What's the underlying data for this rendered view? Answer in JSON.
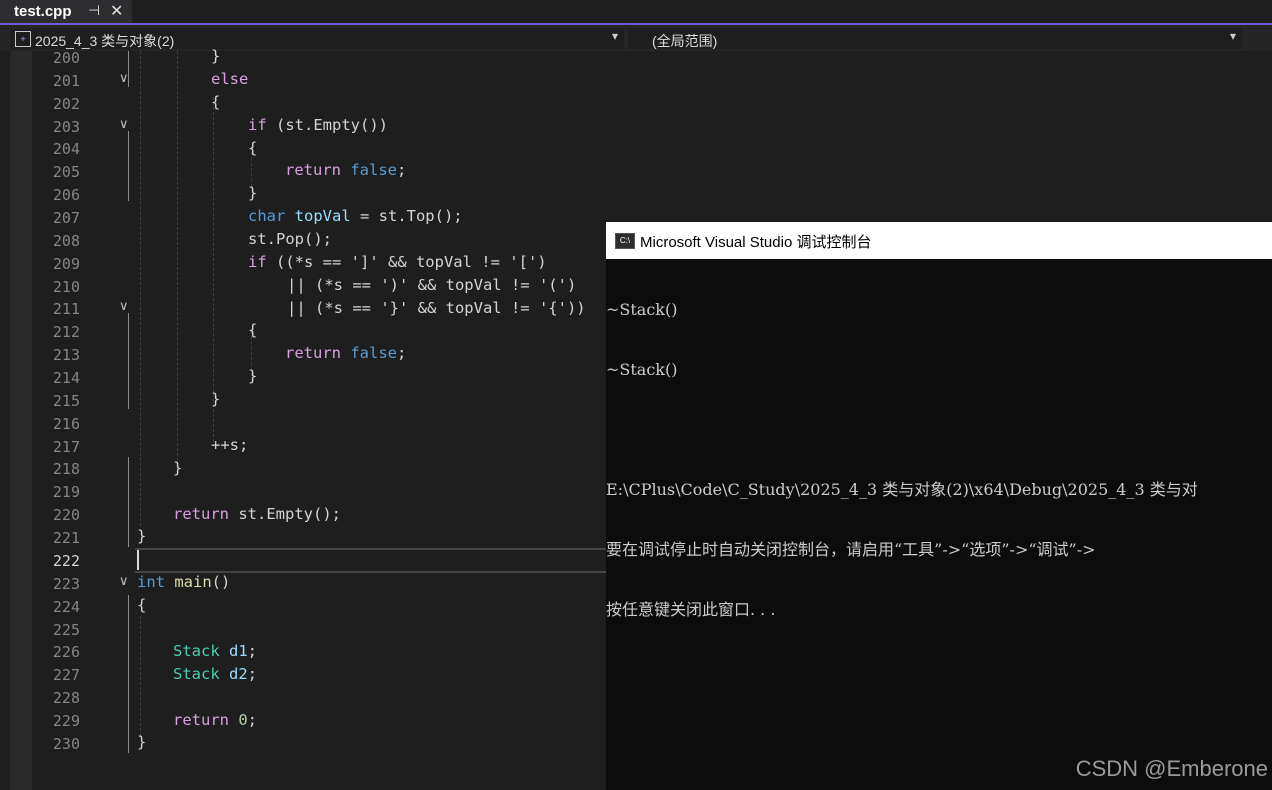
{
  "tab": {
    "title": "test.cpp",
    "pin": "⊣",
    "close": "✕"
  },
  "navbar": {
    "project": "2025_4_3 类与对象(2)",
    "scope": "(全局范围)",
    "arrow": "▾"
  },
  "editor": {
    "line_numbers": [
      "200",
      "201",
      "202",
      "203",
      "204",
      "205",
      "206",
      "207",
      "208",
      "209",
      "210",
      "211",
      "212",
      "213",
      "214",
      "215",
      "216",
      "217",
      "218",
      "219",
      "220",
      "221",
      "222",
      "223",
      "224",
      "225",
      "226",
      "227",
      "228",
      "229",
      "230"
    ],
    "current_line": "222",
    "code": {
      "l200": "}",
      "l201": "else",
      "l202": "{",
      "l203_if": "if",
      "l203_rest": " (st.Empty())",
      "l204": "{",
      "l205_ret": "return",
      "l205_false": " false",
      "l205_end": ";",
      "l206": "}",
      "l207_char": "char",
      "l207_var": " topVal",
      "l207_rest": " = st.Top();",
      "l208": "st.Pop();",
      "l209_if": "if",
      "l209_rest": " ((*s == ']' && topVal != '[')",
      "l210": "|| (*s == ')' && topVal != '(')",
      "l211": "|| (*s == '}' && topVal != '{'))",
      "l212": "{",
      "l213_ret": "return",
      "l213_false": " false",
      "l213_end": ";",
      "l214": "}",
      "l215": "}",
      "l217": "++s;",
      "l218": "}",
      "l220_ret": "return",
      "l220_rest": " st.Empty();",
      "l221": "}",
      "l223_int": "int",
      "l223_fn": " main",
      "l223_rest": "()",
      "l224": "{",
      "l226_ty": "Stack",
      "l226_var": " d1",
      "l226_end": ";",
      "l227_ty": "Stack",
      "l227_var": " d2",
      "l227_end": ";",
      "l229_ret": "return",
      "l229_num": " 0",
      "l229_end": ";",
      "l230": "}"
    }
  },
  "console": {
    "icon_text": "C:\\",
    "title": "Microsoft Visual Studio 调试控制台",
    "lines": [
      "~Stack()",
      "~Stack()",
      "",
      "E:\\CPlus\\Code\\C_Study\\2025_4_3 类与对象(2)\\x64\\Debug\\2025_4_3 类与对",
      "要在调试停止时自动关闭控制台，请启用“工具”->“选项”->“调试”->",
      "按任意键关闭此窗口. . ."
    ]
  },
  "watermark": "CSDN @Emberone",
  "colors": {
    "accent": "#6f5bd6",
    "keyword": "#569cd6",
    "control": "#d8a0df",
    "type": "#4ec9b0",
    "variable": "#9cdcfe",
    "function": "#dcdcaa",
    "string": "#d69d85"
  }
}
